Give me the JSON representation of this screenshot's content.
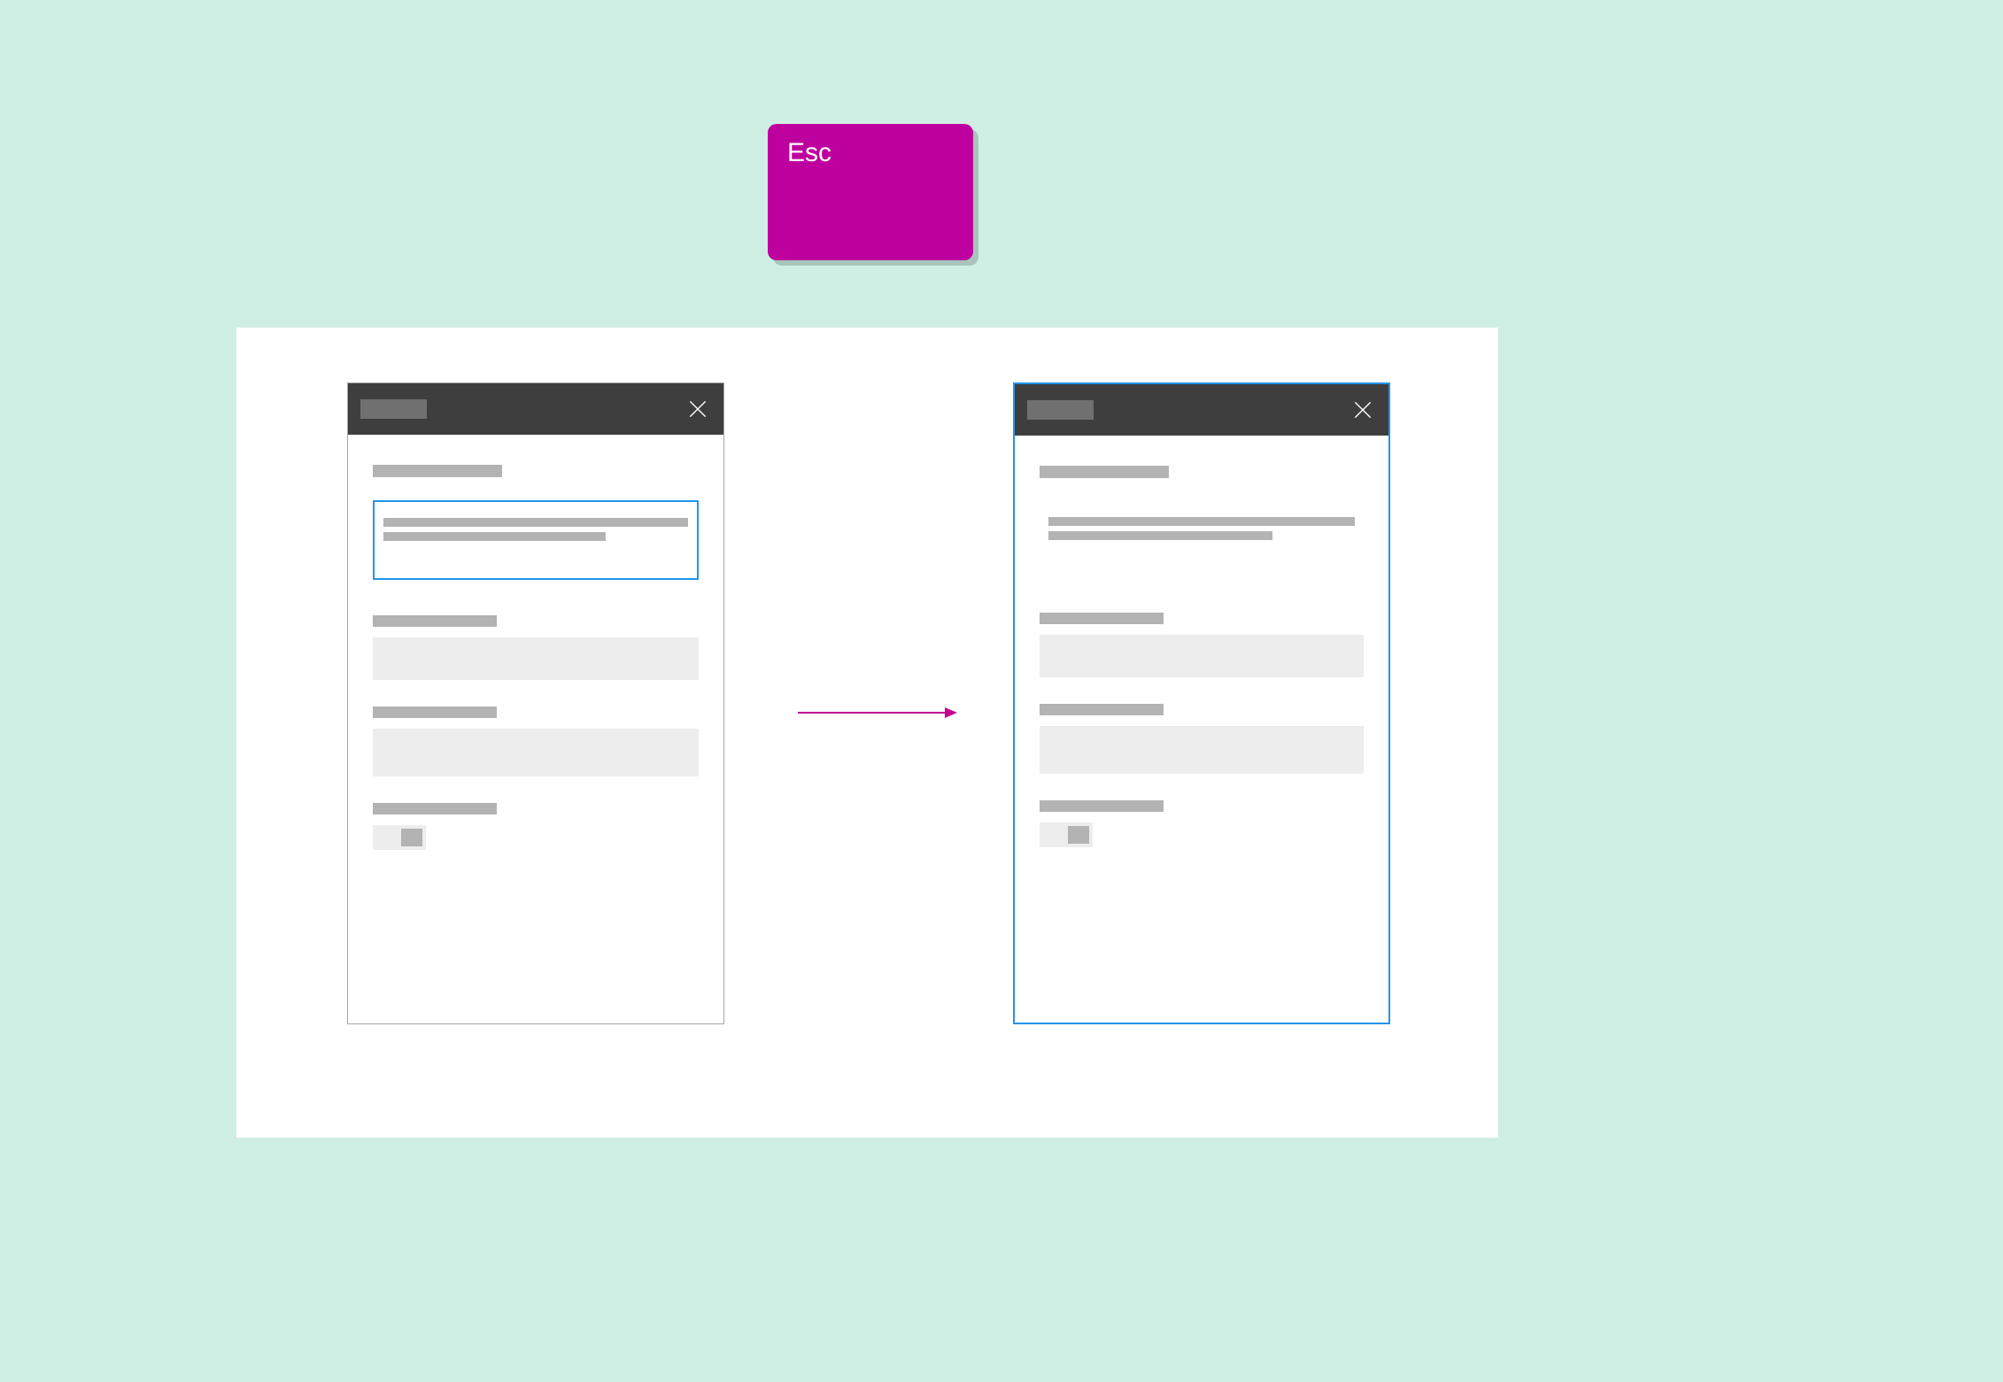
{
  "key": {
    "label": "Esc"
  },
  "colors": {
    "bg": "#CFEFE4",
    "key": "#BE009E",
    "arrow": "#C40394",
    "focus": "#2295E9",
    "titlebar": "#3E3E3E"
  },
  "diagram": {
    "left_dialog_state": "inner-field-focused",
    "right_dialog_state": "dialog-focused"
  }
}
